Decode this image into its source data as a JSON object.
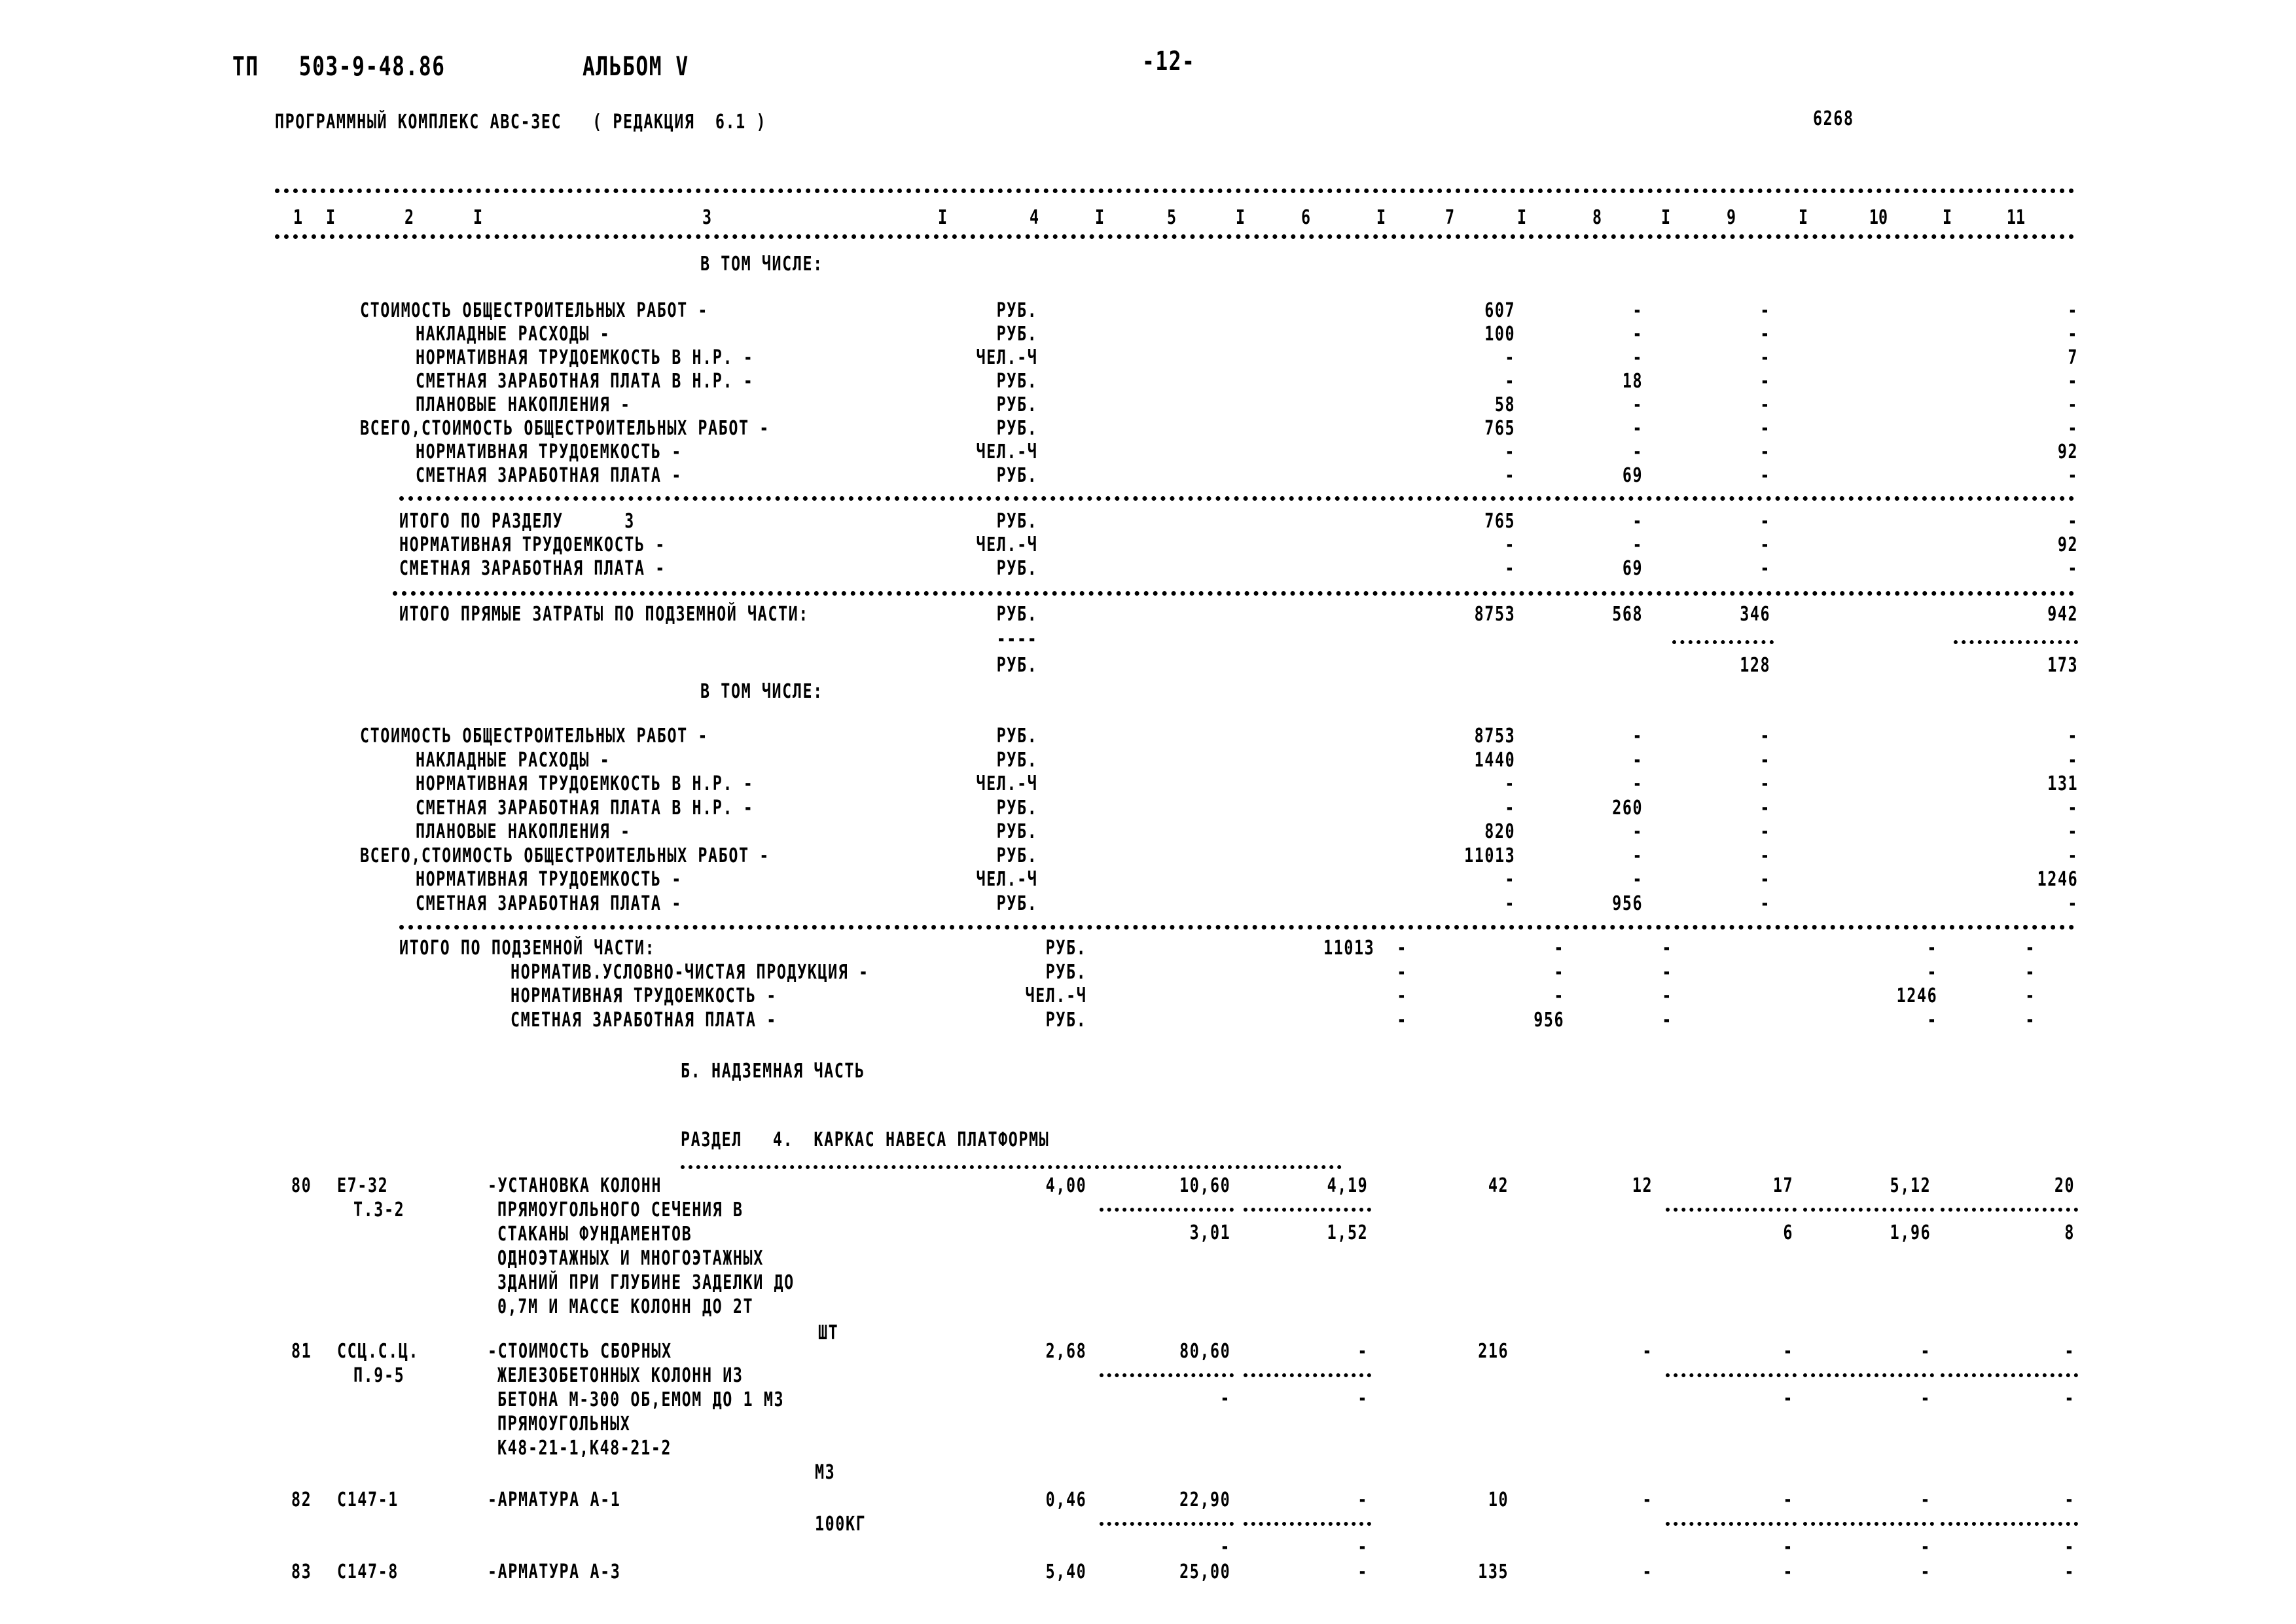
{
  "header": {
    "doc_code": "ТП   503-9-48.86",
    "album": "АЛЬБОМ V",
    "page_number": "-12-",
    "program": "ПРОГРАММНЫЙ КОМПЛЕКС АВС-3ЕС   ( РЕДАКЦИЯ  6.1 )",
    "sheet_code": "6268"
  },
  "table_header": {
    "columns": [
      "1",
      "2",
      "3",
      "4",
      "5",
      "6",
      "7",
      "8",
      "9",
      "10",
      "11"
    ],
    "separators": "I"
  },
  "section3_breakdown": {
    "heading": "В ТОМ ЧИСЛЕ:",
    "rows": [
      {
        "label": "СТОИМОСТЬ ОБЩЕСТРОИТЕЛЬНЫХ РАБОТ -",
        "unit": "РУБ.",
        "c7": "607",
        "c8": "-",
        "c9": "-",
        "c11": "-",
        "indent": false
      },
      {
        "label": "НАКЛАДНЫЕ РАСХОДЫ -",
        "unit": "РУБ.",
        "c7": "100",
        "c8": "-",
        "c9": "-",
        "c11": "-",
        "indent": true
      },
      {
        "label": "НОРМАТИВНАЯ ТРУДОЕМКОСТЬ В Н.Р. -",
        "unit": "ЧЕЛ.-Ч",
        "c7": "-",
        "c8": "-",
        "c9": "-",
        "c11": "7",
        "indent": true
      },
      {
        "label": "СМЕТНАЯ ЗАРАБОТНАЯ ПЛАТА В Н.Р. -",
        "unit": "РУБ.",
        "c7": "-",
        "c8": "18",
        "c9": "-",
        "c11": "-",
        "indent": true
      },
      {
        "label": "ПЛАНОВЫЕ НАКОПЛЕНИЯ -",
        "unit": "РУБ.",
        "c7": "58",
        "c8": "-",
        "c9": "-",
        "c11": "-",
        "indent": true
      },
      {
        "label": "ВСЕГО,СТОИМОСТЬ ОБЩЕСТРОИТЕЛЬНЫХ РАБОТ -",
        "unit": "РУБ.",
        "c7": "765",
        "c8": "-",
        "c9": "-",
        "c11": "-",
        "indent": false
      },
      {
        "label": "НОРМАТИВНАЯ ТРУДОЕМКОСТЬ -",
        "unit": "ЧЕЛ.-Ч",
        "c7": "-",
        "c8": "-",
        "c9": "-",
        "c11": "92",
        "indent": true
      },
      {
        "label": "СМЕТНАЯ ЗАРАБОТНАЯ ПЛАТА -",
        "unit": "РУБ.",
        "c7": "-",
        "c8": "69",
        "c9": "-",
        "c11": "-",
        "indent": true
      }
    ]
  },
  "section3_total": {
    "rows": [
      {
        "label": "ИТОГО ПО РАЗДЕЛУ      3",
        "unit": "РУБ.",
        "c7": "765",
        "c8": "-",
        "c9": "-",
        "c11": "-"
      },
      {
        "label": "НОРМАТИВНАЯ ТРУДОЕМКОСТЬ -",
        "unit": "ЧЕЛ.-Ч",
        "c7": "-",
        "c8": "-",
        "c9": "-",
        "c11": "92"
      },
      {
        "label": "СМЕТНАЯ ЗАРАБОТНАЯ ПЛАТА -",
        "unit": "РУБ.",
        "c7": "-",
        "c8": "69",
        "c9": "-",
        "c11": "-"
      }
    ]
  },
  "direct_costs": {
    "label": "ИТОГО ПРЯМЫЕ ЗАТРАТЫ ПО ПОДЗЕМНОЙ ЧАСТИ:",
    "unit": "РУБ.",
    "unit_dash": "----",
    "unit2": "РУБ.",
    "c7": "8753",
    "c8": "568",
    "c9": "346",
    "c11": "942",
    "c9_sub": "128",
    "c11_sub": "173"
  },
  "underground_breakdown": {
    "heading": "В ТОМ ЧИСЛЕ:",
    "rows": [
      {
        "label": "СТОИМОСТЬ ОБЩЕСТРОИТЕЛЬНЫХ РАБОТ -",
        "unit": "РУБ.",
        "c7": "8753",
        "c8": "-",
        "c9": "-",
        "c11": "-",
        "indent": false
      },
      {
        "label": "НАКЛАДНЫЕ РАСХОДЫ -",
        "unit": "РУБ.",
        "c7": "1440",
        "c8": "-",
        "c9": "-",
        "c11": "-",
        "indent": true
      },
      {
        "label": "НОРМАТИВНАЯ ТРУДОЕМКОСТЬ В Н.Р. -",
        "unit": "ЧЕЛ.-Ч",
        "c7": "-",
        "c8": "-",
        "c9": "-",
        "c11": "131",
        "indent": true
      },
      {
        "label": "СМЕТНАЯ ЗАРАБОТНАЯ ПЛАТА В Н.Р. -",
        "unit": "РУБ.",
        "c7": "-",
        "c8": "260",
        "c9": "-",
        "c11": "-",
        "indent": true
      },
      {
        "label": "ПЛАНОВЫЕ НАКОПЛЕНИЯ -",
        "unit": "РУБ.",
        "c7": "820",
        "c8": "-",
        "c9": "-",
        "c11": "-",
        "indent": true
      },
      {
        "label": "ВСЕГО,СТОИМОСТЬ ОБЩЕСТРОИТЕЛЬНЫХ РАБОТ -",
        "unit": "РУБ.",
        "c7": "11013",
        "c8": "-",
        "c9": "-",
        "c11": "-",
        "indent": false
      },
      {
        "label": "НОРМАТИВНАЯ ТРУДОЕМКОСТЬ -",
        "unit": "ЧЕЛ.-Ч",
        "c7": "-",
        "c8": "-",
        "c9": "-",
        "c11": "1246",
        "indent": true
      },
      {
        "label": "СМЕТНАЯ ЗАРАБОТНАЯ ПЛАТА -",
        "unit": "РУБ.",
        "c7": "-",
        "c8": "956",
        "c9": "-",
        "c11": "-",
        "indent": true
      }
    ]
  },
  "underground_total": {
    "rows": [
      {
        "label": "ИТОГО ПО ПОДЗЕМНОЙ ЧАСТИ:",
        "unit": "РУБ.",
        "a": "11013",
        "b": "-",
        "c": "-",
        "d": "-",
        "e": "-",
        "f": "-",
        "indent": false
      },
      {
        "label": "НОРМАТИВ.УСЛОВНО-ЧИСТАЯ ПРОДУКЦИЯ -",
        "unit": "РУБ.",
        "a": "",
        "b": "-",
        "c": "-",
        "d": "-",
        "e": "-",
        "f": "-",
        "indent": true
      },
      {
        "label": "НОРМАТИВНАЯ ТРУДОЕМКОСТЬ -",
        "unit": "ЧЕЛ.-Ч",
        "a": "",
        "b": "-",
        "c": "-",
        "d": "-",
        "e": "1246",
        "f": "-",
        "indent": true
      },
      {
        "label": "СМЕТНАЯ ЗАРАБОТНАЯ ПЛАТА -",
        "unit": "РУБ.",
        "a": "",
        "b": "-",
        "c": "956",
        "d": "-",
        "e": "-",
        "f": "-",
        "indent": true
      }
    ]
  },
  "part_b": {
    "heading": "Б. НАДЗЕМНАЯ ЧАСТЬ",
    "section_title": "РАЗДЕЛ   4.  КАРКАС НАВЕСА ПЛАТФОРМЫ"
  },
  "items": [
    {
      "num": "80",
      "code": "Е7-32",
      "code2": "Т.3-2",
      "desc": [
        "-УСТАНОВКА КОЛОНН",
        "ПРЯМОУГОЛЬНОГО СЕЧЕНИЯ В",
        "СТАКАНЫ ФУНДАМЕНТОВ",
        "ОДНОЭТАЖНЫХ И МНОГОЭТАЖНЫХ",
        "ЗДАНИЙ ПРИ ГЛУБИНЕ ЗАДЕЛКИ ДО",
        "0,7М И МАССЕ КОЛОНН ДО 2Т"
      ],
      "unit": "ШТ",
      "qty": "4,00",
      "price": "10,60",
      "price_sub": "3,01",
      "c6": "4,19",
      "c6_sub": "1,52",
      "c7": "42",
      "c8": "12",
      "c9": "17",
      "c9_sub": "6",
      "c10": "5,12",
      "c10_sub": "1,96",
      "c11": "20",
      "c11_sub": "8"
    },
    {
      "num": "81",
      "code": "ССЦ.С.Ц.",
      "code2": "П.9-5",
      "desc": [
        "-СТОИМОСТЬ СБОРНЫХ",
        "ЖЕЛЕЗОБЕТОННЫХ КОЛОНН ИЗ",
        "БЕТОНА М-300 ОБ,ЕМОМ ДО 1 М3",
        "ПРЯМОУГОЛЬНЫХ",
        "К48-21-1,К48-21-2"
      ],
      "unit": "М3",
      "qty": "2,68",
      "price": "80,60",
      "price_sub": "-",
      "c6": "-",
      "c6_sub": "-",
      "c7": "216",
      "c8": "-",
      "c9": "-",
      "c9_sub": "-",
      "c10": "-",
      "c10_sub": "-",
      "c11": "-",
      "c11_sub": "-"
    },
    {
      "num": "82",
      "code": "С147-1",
      "code2": "",
      "desc": [
        "-АРМАТУРА А-1"
      ],
      "unit": "100КГ",
      "qty": "0,46",
      "price": "22,90",
      "price_sub": "-",
      "c6": "-",
      "c6_sub": "-",
      "c7": "10",
      "c8": "-",
      "c9": "-",
      "c9_sub": "-",
      "c10": "-",
      "c10_sub": "-",
      "c11": "-",
      "c11_sub": "-"
    },
    {
      "num": "83",
      "code": "С147-8",
      "code2": "",
      "desc": [
        "-АРМАТУРА А-3"
      ],
      "unit": "",
      "qty": "5,40",
      "price": "25,00",
      "price_sub": "",
      "c6": "-",
      "c6_sub": "",
      "c7": "135",
      "c8": "-",
      "c9": "-",
      "c9_sub": "",
      "c10": "-",
      "c10_sub": "",
      "c11": "-",
      "c11_sub": ""
    }
  ]
}
